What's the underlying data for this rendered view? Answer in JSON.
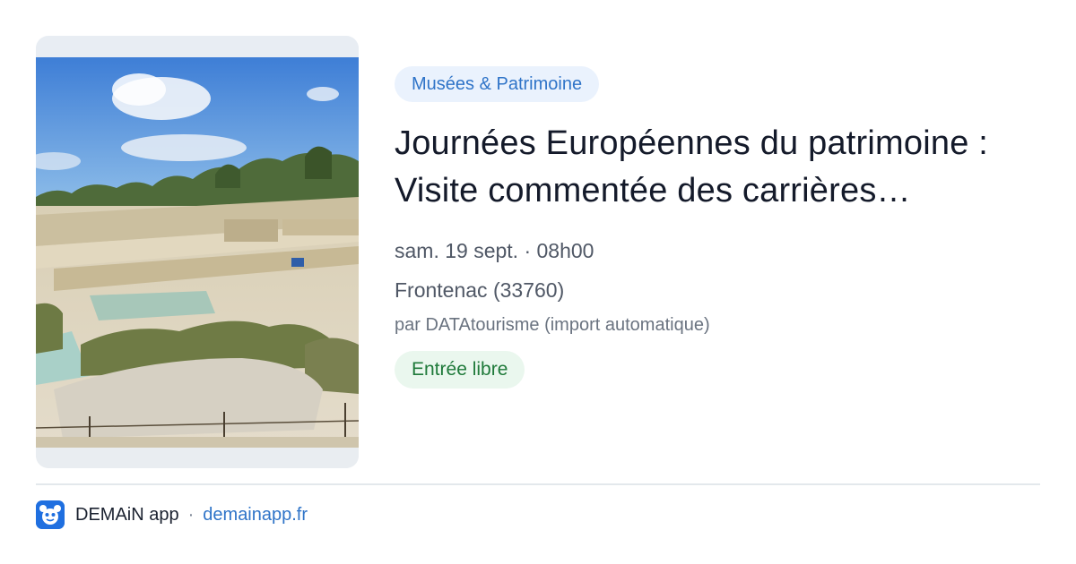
{
  "event": {
    "category": "Musées & Patrimoine",
    "title": "Journées Européennes du patrimoine : Visite commentée des carrières…",
    "date": "sam. 19 sept. · 08h00",
    "location": "Frontenac (33760)",
    "author": "par DATAtourisme (import automatique)",
    "price": "Entrée libre",
    "image_icon": "quarry-landscape-photo"
  },
  "footer": {
    "app_name": "DEMAiN app",
    "separator": "·",
    "link": "demainapp.fr",
    "logo_icon": "demain-mascot-icon"
  },
  "colors": {
    "category_bg": "#eaf2fd",
    "category_text": "#2f74c8",
    "price_bg": "#eaf7ee",
    "price_text": "#1f7a3a",
    "title_text": "#141a2a",
    "link": "#2f74c8",
    "logo_bg": "#1f6fe0"
  }
}
